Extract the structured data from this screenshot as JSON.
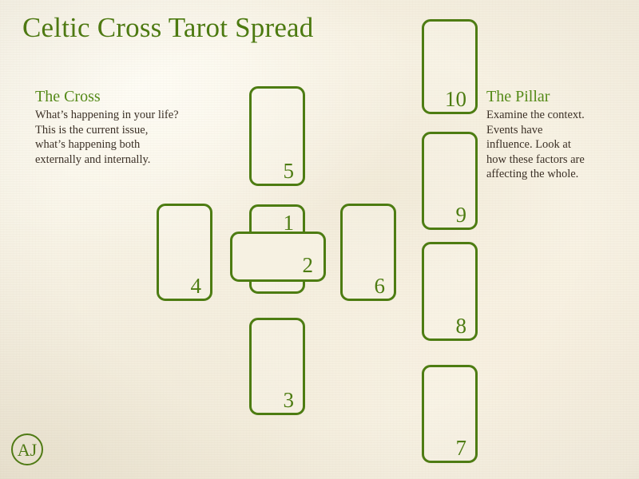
{
  "page": {
    "title": "Celtic Cross Tarot Spread",
    "background_color": "#f7f2e3",
    "accent_color": "#4d7c12",
    "text_color": "#3b3026"
  },
  "panels": {
    "cross": {
      "title": "The Cross",
      "body": "What’s happening in your life?\nThis is the current issue,\nwhat’s happening both\nexternally and internally."
    },
    "pillar": {
      "title": "The Pillar",
      "body": "Examine the context.\nEvents have\ninfluence. Look at\nhow these factors are\naffecting the whole."
    }
  },
  "cards": [
    {
      "number": "5",
      "group": "cross",
      "orientation": "vertical"
    },
    {
      "number": "4",
      "group": "cross",
      "orientation": "vertical"
    },
    {
      "number": "1",
      "group": "cross",
      "orientation": "vertical"
    },
    {
      "number": "2",
      "group": "cross",
      "orientation": "horizontal"
    },
    {
      "number": "6",
      "group": "cross",
      "orientation": "vertical"
    },
    {
      "number": "3",
      "group": "cross",
      "orientation": "vertical"
    },
    {
      "number": "10",
      "group": "pillar",
      "orientation": "vertical"
    },
    {
      "number": "9",
      "group": "pillar",
      "orientation": "vertical"
    },
    {
      "number": "8",
      "group": "pillar",
      "orientation": "vertical"
    },
    {
      "number": "7",
      "group": "pillar",
      "orientation": "vertical"
    }
  ],
  "logo": {
    "monogram": "AJ",
    "shape": "circle"
  }
}
